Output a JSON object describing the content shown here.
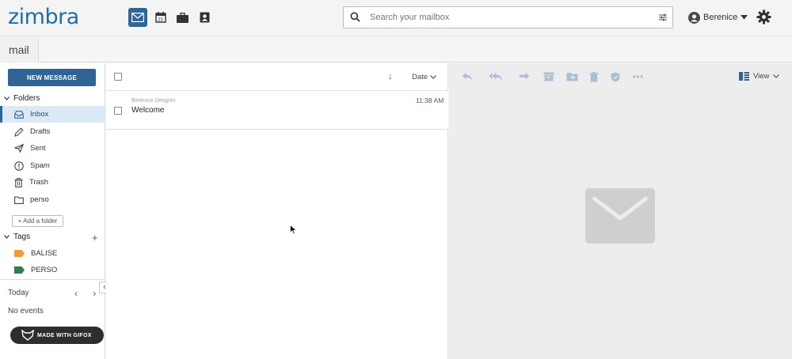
{
  "header": {
    "logo_text": "zimbra",
    "search_placeholder": "Search your mailbox",
    "user_name": "Berenice",
    "apps": [
      "mail-icon",
      "calendar-icon",
      "briefcase-icon",
      "contacts-icon"
    ]
  },
  "tab": {
    "label": "mail"
  },
  "sidebar": {
    "new_message_label": "NEW MESSAGE",
    "folders_heading": "Folders",
    "folders": [
      {
        "label": "Inbox",
        "icon": "inbox-icon",
        "selected": true
      },
      {
        "label": "Drafts",
        "icon": "pencil-icon"
      },
      {
        "label": "Sent",
        "icon": "paper-plane-icon"
      },
      {
        "label": "Spam",
        "icon": "alert-circle-icon"
      },
      {
        "label": "Trash",
        "icon": "trash-icon"
      },
      {
        "label": "perso",
        "icon": "folder-icon"
      }
    ],
    "add_folder_label": "+ Add a folder",
    "tags_heading": "Tags",
    "tags_add": "+",
    "tags": [
      {
        "label": "BALISE",
        "color": "#f09a3e"
      },
      {
        "label": "PERSO",
        "color": "#2e7d4f"
      }
    ],
    "calendar_today": "Today",
    "calendar_nav": "‹ ›",
    "calendar_empty": "No events",
    "collapse_glyph": "‹"
  },
  "message_list": {
    "sort_label": "Date",
    "sort_arrow": "↓",
    "messages": [
      {
        "sender": "Berenice Desgrés",
        "subject": "Welcome",
        "time": "11:38 AM"
      }
    ]
  },
  "reading_pane": {
    "toolbar": [
      "reply-icon",
      "reply-all-icon",
      "forward-icon",
      "archive-icon",
      "move-to-folder-icon",
      "delete-icon",
      "spam-shield-icon",
      "more-icon"
    ],
    "view_label": "View"
  },
  "overlay": {
    "gifox_label": "MADE WITH GIFOX"
  },
  "colors": {
    "brand": "#2f6594",
    "logo": "#1f6fa8",
    "selected_bg": "#dbe9f4"
  }
}
